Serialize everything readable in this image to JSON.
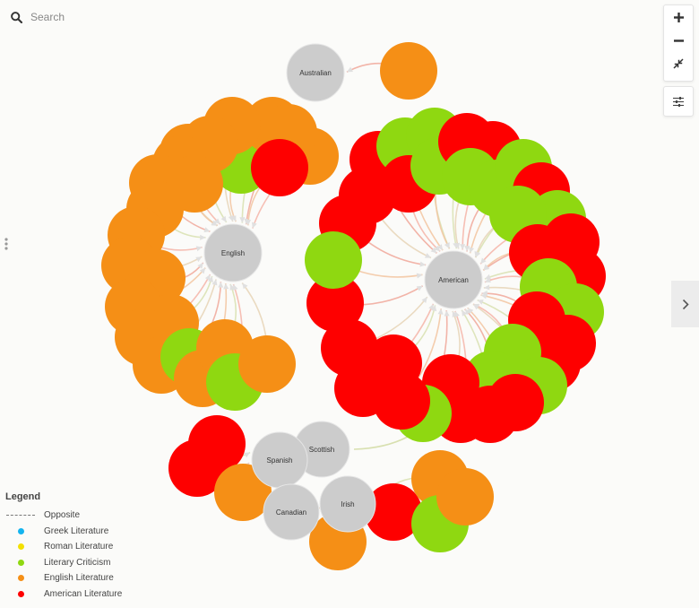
{
  "search": {
    "placeholder": "Search"
  },
  "colors": {
    "greek": "#14b4ef",
    "roman": "#f3e000",
    "criticism": "#8fd811",
    "english": "#f58f16",
    "american": "#fe0000",
    "hub": "#cccccc",
    "edge": "#f2b39a"
  },
  "hubs": [
    {
      "id": "australian",
      "label": "Australian"
    },
    {
      "id": "english",
      "label": "English"
    },
    {
      "id": "american",
      "label": "American"
    },
    {
      "id": "scottish",
      "label": "Scottish"
    },
    {
      "id": "spanish",
      "label": "Spanish"
    },
    {
      "id": "irish",
      "label": "Irish"
    },
    {
      "id": "canadian",
      "label": "Canadian"
    }
  ],
  "legend": {
    "title": "Legend",
    "items": [
      {
        "label": "Opposite",
        "style": "dash"
      },
      {
        "label": "Greek Literature",
        "color_key": "greek"
      },
      {
        "label": "Roman Literature",
        "color_key": "roman"
      },
      {
        "label": "Literary Criticism",
        "color_key": "criticism"
      },
      {
        "label": "English Literature",
        "color_key": "english"
      },
      {
        "label": "American Literature",
        "color_key": "american"
      }
    ]
  },
  "controls": {
    "zoom_in": "zoom-in",
    "zoom_out": "zoom-out",
    "fit": "fit-to-screen",
    "settings": "settings-sliders",
    "expand": "chevron-right"
  }
}
